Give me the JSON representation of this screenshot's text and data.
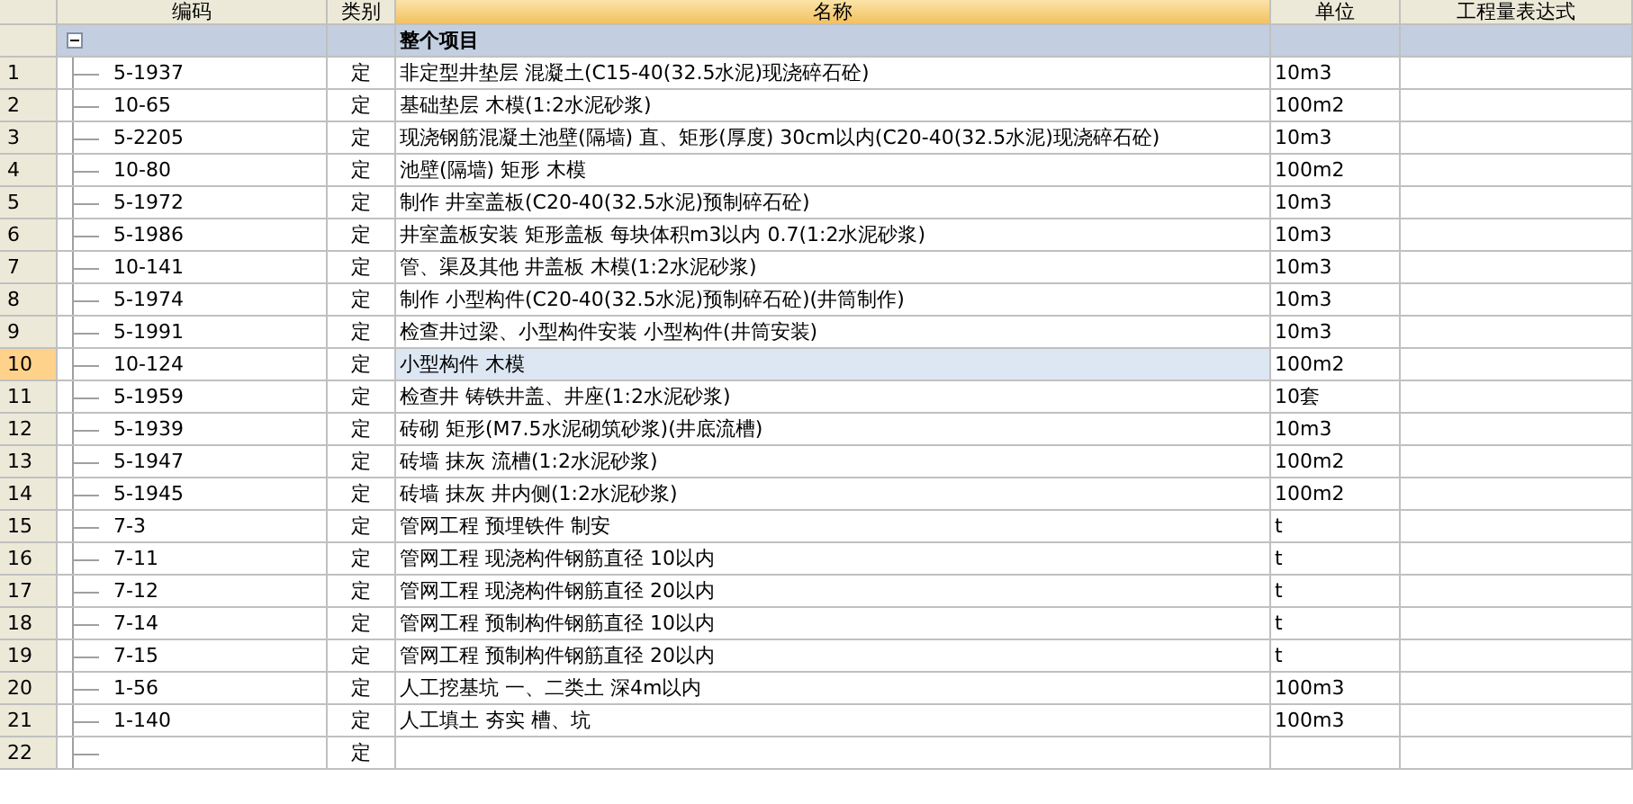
{
  "columns": [
    {
      "label": "编码",
      "selected": false
    },
    {
      "label": "类别",
      "selected": false
    },
    {
      "label": "名称",
      "selected": true
    },
    {
      "label": "单位",
      "selected": false
    },
    {
      "label": "工程量表达式",
      "selected": false
    }
  ],
  "group": {
    "label": "整个项目",
    "expanded": true
  },
  "rows": [
    {
      "number": "1",
      "code": "5-1937",
      "type": "定",
      "name": "非定型井垫层 混凝土(C15-40(32.5水泥)现浇碎石砼)",
      "unit": "10m3",
      "selected": false
    },
    {
      "number": "2",
      "code": "10-65",
      "type": "定",
      "name": "基础垫层 木模(1:2水泥砂浆)",
      "unit": "100m2",
      "selected": false
    },
    {
      "number": "3",
      "code": "5-2205",
      "type": "定",
      "name": "现浇钢筋混凝土池壁(隔墙) 直、矩形(厚度) 30cm以内(C20-40(32.5水泥)现浇碎石砼)",
      "unit": "10m3",
      "selected": false
    },
    {
      "number": "4",
      "code": "10-80",
      "type": "定",
      "name": "池壁(隔墙) 矩形 木模",
      "unit": "100m2",
      "selected": false
    },
    {
      "number": "5",
      "code": "5-1972",
      "type": "定",
      "name": "制作 井室盖板(C20-40(32.5水泥)预制碎石砼)",
      "unit": "10m3",
      "selected": false
    },
    {
      "number": "6",
      "code": "5-1986",
      "type": "定",
      "name": "井室盖板安装 矩形盖板 每块体积m3以内 0.7(1:2水泥砂浆)",
      "unit": "10m3",
      "selected": false
    },
    {
      "number": "7",
      "code": "10-141",
      "type": "定",
      "name": "管、渠及其他 井盖板 木模(1:2水泥砂浆)",
      "unit": "10m3",
      "selected": false
    },
    {
      "number": "8",
      "code": "5-1974",
      "type": "定",
      "name": "制作 小型构件(C20-40(32.5水泥)预制碎石砼)(井筒制作)",
      "unit": "10m3",
      "selected": false
    },
    {
      "number": "9",
      "code": "5-1991",
      "type": "定",
      "name": "检查井过梁、小型构件安装 小型构件(井筒安装)",
      "unit": "10m3",
      "selected": false
    },
    {
      "number": "10",
      "code": "10-124",
      "type": "定",
      "name": "小型构件 木模",
      "unit": "100m2",
      "selected": true
    },
    {
      "number": "11",
      "code": "5-1959",
      "type": "定",
      "name": "检查井 铸铁井盖、井座(1:2水泥砂浆)",
      "unit": "10套",
      "selected": false
    },
    {
      "number": "12",
      "code": "5-1939",
      "type": "定",
      "name": "砖砌 矩形(M7.5水泥砌筑砂浆)(井底流槽)",
      "unit": "10m3",
      "selected": false
    },
    {
      "number": "13",
      "code": "5-1947",
      "type": "定",
      "name": "砖墙 抹灰 流槽(1:2水泥砂浆)",
      "unit": "100m2",
      "selected": false
    },
    {
      "number": "14",
      "code": "5-1945",
      "type": "定",
      "name": "砖墙 抹灰 井内侧(1:2水泥砂浆)",
      "unit": "100m2",
      "selected": false
    },
    {
      "number": "15",
      "code": "7-3",
      "type": "定",
      "name": "管网工程 预埋铁件 制安",
      "unit": "t",
      "selected": false
    },
    {
      "number": "16",
      "code": "7-11",
      "type": "定",
      "name": "管网工程 现浇构件钢筋直径 10以内",
      "unit": "t",
      "selected": false
    },
    {
      "number": "17",
      "code": "7-12",
      "type": "定",
      "name": "管网工程 现浇构件钢筋直径 20以内",
      "unit": "t",
      "selected": false
    },
    {
      "number": "18",
      "code": "7-14",
      "type": "定",
      "name": "管网工程 预制构件钢筋直径 10以内",
      "unit": "t",
      "selected": false
    },
    {
      "number": "19",
      "code": "7-15",
      "type": "定",
      "name": "管网工程 预制构件钢筋直径 20以内",
      "unit": "t",
      "selected": false
    },
    {
      "number": "20",
      "code": "1-56",
      "type": "定",
      "name": "人工挖基坑 一、二类土 深4m以内",
      "unit": "100m3",
      "selected": false
    },
    {
      "number": "21",
      "code": "1-140",
      "type": "定",
      "name": "人工填土 夯实 槽、坑",
      "unit": "100m3",
      "selected": false
    },
    {
      "number": "22",
      "type": "定",
      "selected": false
    }
  ]
}
